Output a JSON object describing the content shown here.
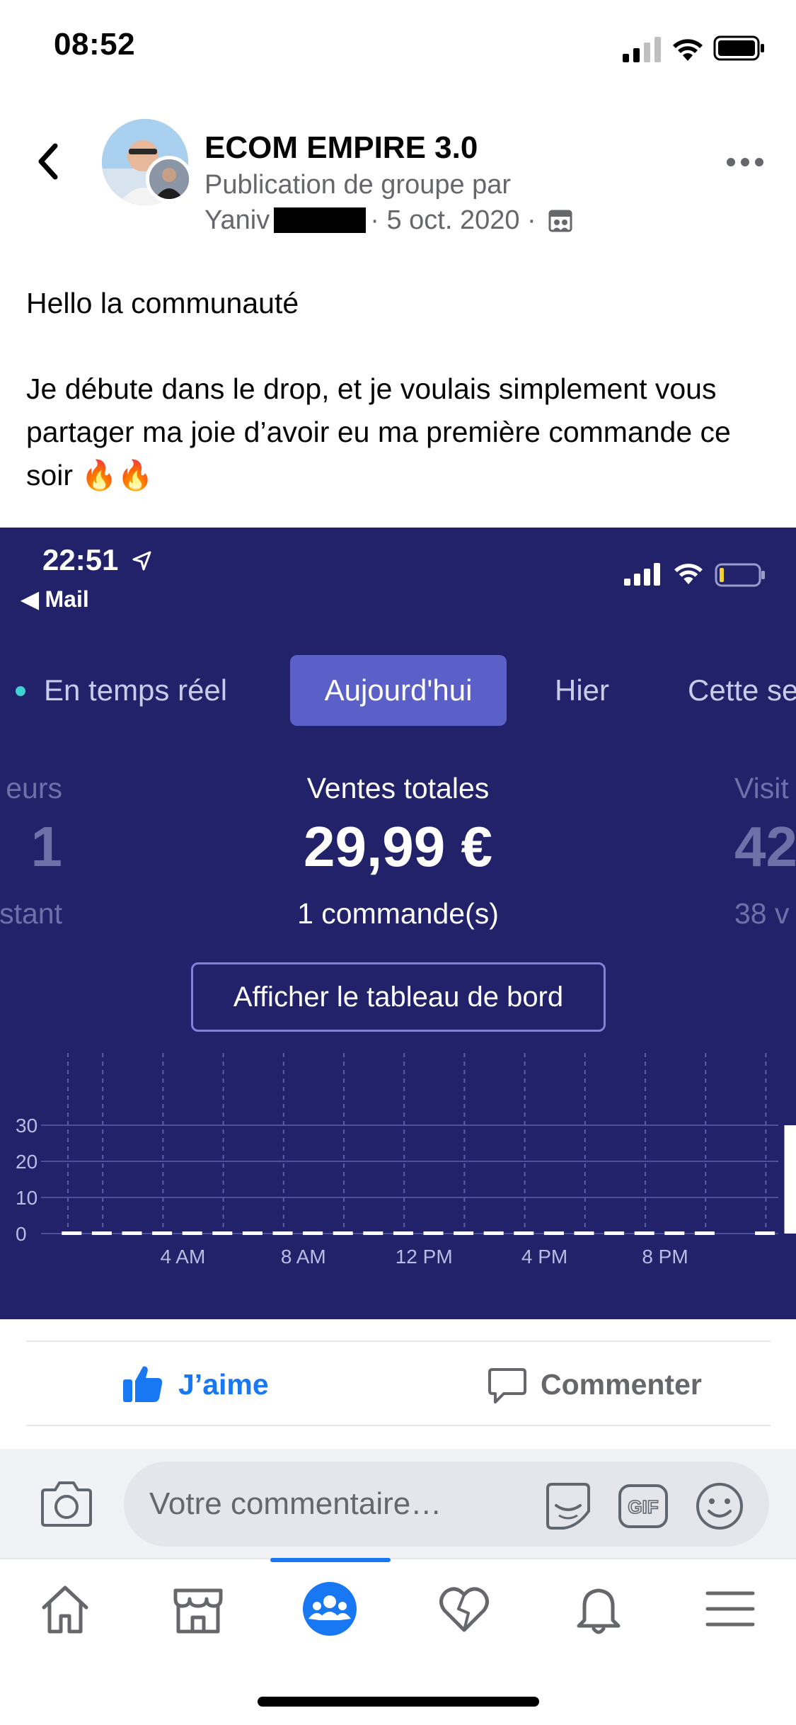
{
  "status_bar": {
    "time": "08:52",
    "icons": [
      "signal-icon",
      "wifi-icon",
      "battery-icon"
    ]
  },
  "header": {
    "group_name": "ECOM EMPIRE 3.0",
    "subtitle_line1": "Publication de groupe par",
    "author_first_name": "Yaniv",
    "date": "· 5 oct. 2020 ·",
    "icons": [
      "back-chevron-icon",
      "group-privacy-icon",
      "more-dots-icon"
    ]
  },
  "post": {
    "paragraph1": "Hello la communauté",
    "paragraph2": "Je débute dans le drop, et je voulais simplement vous partager ma joie d’avoir eu ma première commande ce soir 🔥🔥"
  },
  "embedded_screenshot": {
    "time": "22:51",
    "back_app": "◀ Mail",
    "tabs": [
      "En temps réel",
      "Aujourd'hui",
      "Hier",
      "Cette se"
    ],
    "active_tab": "Aujourd'hui",
    "left_metric": {
      "label": "eurs",
      "value": "1",
      "sub": "stant"
    },
    "center_metric": {
      "label": "Ventes totales",
      "value": "29,99 €",
      "sub": "1 commande(s)"
    },
    "right_metric": {
      "label": "Visit",
      "value": "42",
      "sub": "38 v"
    },
    "dashboard_button": "Afficher le tableau de bord",
    "colors": {
      "background": "#22226b",
      "accent": "#5b60c8",
      "bar": "#ffffff"
    }
  },
  "chart_data": {
    "type": "bar",
    "categories": [
      "12 AM",
      "1 AM",
      "2 AM",
      "3 AM",
      "4 AM",
      "5 AM",
      "6 AM",
      "7 AM",
      "8 AM",
      "9 AM",
      "10 AM",
      "11 AM",
      "12 PM",
      "1 PM",
      "2 PM",
      "3 PM",
      "4 PM",
      "5 PM",
      "6 PM",
      "7 PM",
      "8 PM",
      "9 PM",
      "10 PM",
      "11 PM"
    ],
    "x_tick_labels": [
      "4 AM",
      "8 AM",
      "12 PM",
      "4 PM",
      "8 PM"
    ],
    "x_tick_indices": [
      4,
      8,
      12,
      16,
      20
    ],
    "values": [
      0,
      0,
      0,
      0,
      0,
      0,
      0,
      0,
      0,
      0,
      0,
      0,
      0,
      0,
      0,
      0,
      0,
      0,
      0,
      0,
      0,
      0,
      29.99,
      0
    ],
    "y_ticks": [
      "0",
      "10",
      "20",
      "30"
    ],
    "ylim": [
      0,
      30
    ],
    "grid": true
  },
  "actions": {
    "like_label": "J’aime",
    "comment_label": "Commenter"
  },
  "composer": {
    "placeholder": "Votre commentaire…",
    "gif_label": "GIF"
  },
  "bottom_nav": {
    "items": [
      "home-icon",
      "marketplace-icon",
      "groups-icon",
      "dating-icon",
      "notifications-icon",
      "menu-icon"
    ],
    "active": "groups-icon",
    "active_color": "#1877f2"
  }
}
